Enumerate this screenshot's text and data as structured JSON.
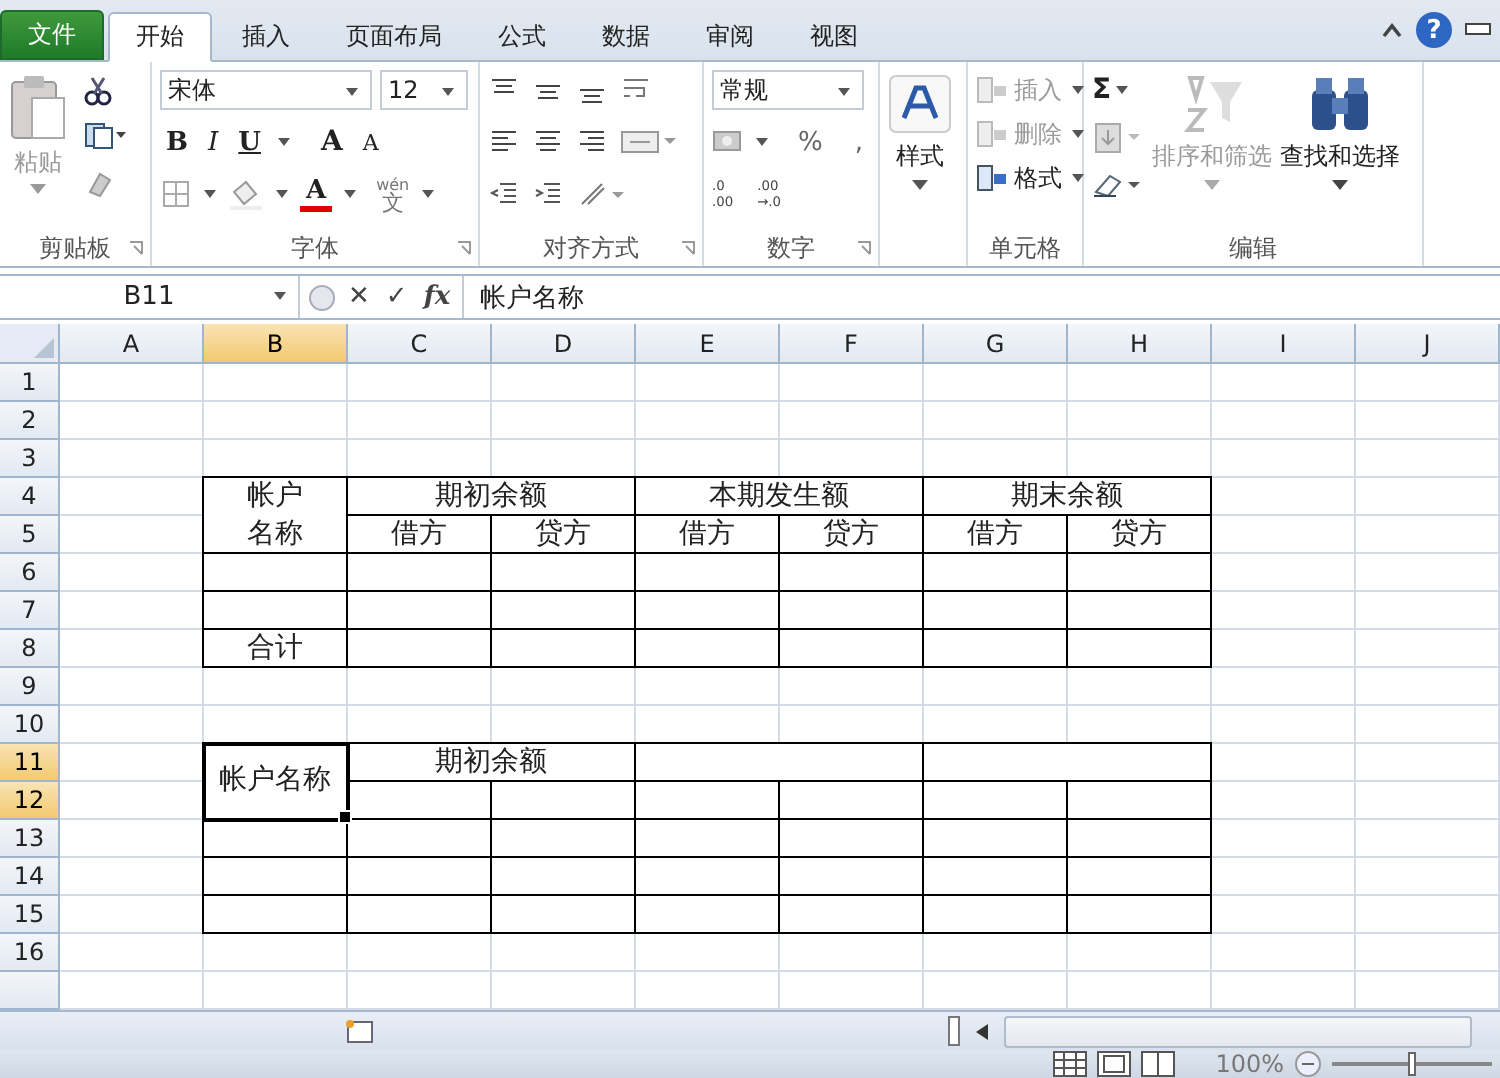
{
  "tabs": [
    {
      "label": "文件",
      "kind": "file",
      "selected": false
    },
    {
      "label": "开始",
      "kind": "tab",
      "selected": true
    },
    {
      "label": "插入",
      "kind": "tab",
      "selected": false
    },
    {
      "label": "页面布局",
      "kind": "tab",
      "selected": false
    },
    {
      "label": "公式",
      "kind": "tab",
      "selected": false
    },
    {
      "label": "数据",
      "kind": "tab",
      "selected": false
    },
    {
      "label": "审阅",
      "kind": "tab",
      "selected": false
    },
    {
      "label": "视图",
      "kind": "tab",
      "selected": false
    }
  ],
  "help": "?",
  "ribbon": {
    "groups": [
      {
        "kind": "clipboard",
        "label": "剪贴板",
        "paste": {
          "label": "粘贴",
          "disabled": true
        }
      },
      {
        "kind": "font",
        "label": "字体",
        "font_name": "宋体",
        "font_size": "12",
        "bold": "B",
        "italic": "I",
        "underline": "U",
        "grow": "A",
        "shrink": "A",
        "font_color": {
          "letter": "A",
          "color": "#e00000"
        },
        "phonetic": {
          "top": "wén",
          "bottom": "文"
        }
      },
      {
        "kind": "alignment",
        "label": "对齐方式"
      },
      {
        "kind": "number",
        "label": "数字",
        "format": "常规",
        "percent": "%",
        "comma": ",",
        "decimals": [
          {
            "top": ".0",
            "bottom": ".00"
          },
          {
            "top": ".00",
            "bottom": "→.0"
          }
        ]
      },
      {
        "kind": "styles",
        "button": "样式"
      },
      {
        "kind": "cells",
        "label": "单元格",
        "items": [
          {
            "label": "插入",
            "disabled": true
          },
          {
            "label": "删除",
            "disabled": true
          },
          {
            "label": "格式",
            "disabled": false
          }
        ]
      },
      {
        "kind": "editing",
        "label": "编辑",
        "sum": "Σ",
        "sort": {
          "label": "排序和筛选",
          "disabled": true
        },
        "find": {
          "label": "查找和选择",
          "disabled": false
        }
      }
    ]
  },
  "formula_bar": {
    "name_box": "B11",
    "cancel": "✕",
    "enter": "✓",
    "function_label": "fx",
    "formula": "帐户名称"
  },
  "sheet": {
    "columns": [
      {
        "label": "A",
        "selected": false
      },
      {
        "label": "B",
        "selected": true
      },
      {
        "label": "C",
        "selected": false
      },
      {
        "label": "D",
        "selected": false
      },
      {
        "label": "E",
        "selected": false
      },
      {
        "label": "F",
        "selected": false
      },
      {
        "label": "G",
        "selected": false
      },
      {
        "label": "H",
        "selected": false
      },
      {
        "label": "I",
        "selected": false
      },
      {
        "label": "J",
        "selected": false
      }
    ],
    "rows": [
      {
        "label": "1",
        "selected": false
      },
      {
        "label": "2",
        "selected": false
      },
      {
        "label": "3",
        "selected": false
      },
      {
        "label": "4",
        "selected": false,
        "cells": [
          {
            "kind": "tall",
            "wrap": true,
            "text": "帐户名称",
            "selected": false
          },
          {
            "kind": "wide",
            "text": "期初余额",
            "selected": false
          },
          {
            "kind": "wide",
            "text": "本期发生额",
            "selected": false
          },
          {
            "kind": "wide",
            "text": "期末余额",
            "selected": false
          }
        ]
      },
      {
        "label": "5",
        "selected": false,
        "cells": [
          {
            "kind": "single",
            "text": "借方",
            "selected": false
          },
          {
            "kind": "single",
            "text": "贷方",
            "selected": false
          },
          {
            "kind": "single",
            "text": "借方",
            "selected": false
          },
          {
            "kind": "single",
            "text": "贷方",
            "selected": false
          },
          {
            "kind": "single",
            "text": "借方",
            "selected": false
          },
          {
            "kind": "single",
            "text": "贷方",
            "selected": false
          }
        ]
      },
      {
        "label": "6",
        "selected": false,
        "cells": [
          {
            "kind": "single",
            "selected": false
          },
          {
            "kind": "single",
            "selected": false
          },
          {
            "kind": "single",
            "selected": false
          },
          {
            "kind": "single",
            "selected": false
          },
          {
            "kind": "single",
            "selected": false
          },
          {
            "kind": "single",
            "selected": false
          },
          {
            "kind": "single",
            "selected": false
          }
        ]
      },
      {
        "label": "7",
        "selected": false,
        "cells": [
          {
            "kind": "single",
            "selected": false
          },
          {
            "kind": "single",
            "selected": false
          },
          {
            "kind": "single",
            "selected": false
          },
          {
            "kind": "single",
            "selected": false
          },
          {
            "kind": "single",
            "selected": false
          },
          {
            "kind": "single",
            "selected": false
          },
          {
            "kind": "single",
            "selected": false
          }
        ]
      },
      {
        "label": "8",
        "selected": false,
        "cells": [
          {
            "kind": "single",
            "text": "合计",
            "selected": false
          },
          {
            "kind": "single",
            "selected": false
          },
          {
            "kind": "single",
            "selected": false
          },
          {
            "kind": "single",
            "selected": false
          },
          {
            "kind": "single",
            "selected": false
          },
          {
            "kind": "single",
            "selected": false
          },
          {
            "kind": "single",
            "selected": false
          }
        ]
      },
      {
        "label": "9",
        "selected": false
      },
      {
        "label": "10",
        "selected": false
      },
      {
        "label": "11",
        "selected": true,
        "cells": [
          {
            "kind": "tall",
            "wrap": false,
            "text": "帐户名称",
            "selected": true
          },
          {
            "kind": "wide",
            "text": "期初余额",
            "selected": false
          },
          {
            "kind": "wide",
            "selected": false
          },
          {
            "kind": "wide",
            "selected": false
          }
        ]
      },
      {
        "label": "12",
        "selected": true,
        "cells": [
          {
            "kind": "single",
            "selected": false
          },
          {
            "kind": "single",
            "selected": false
          },
          {
            "kind": "single",
            "selected": false
          },
          {
            "kind": "single",
            "selected": false
          },
          {
            "kind": "single",
            "selected": false
          },
          {
            "kind": "single",
            "selected": false
          }
        ]
      },
      {
        "label": "13",
        "selected": false,
        "cells": [
          {
            "kind": "single",
            "selected": false
          },
          {
            "kind": "single",
            "selected": false
          },
          {
            "kind": "single",
            "selected": false
          },
          {
            "kind": "single",
            "selected": false
          },
          {
            "kind": "single",
            "selected": false
          },
          {
            "kind": "single",
            "selected": false
          },
          {
            "kind": "single",
            "selected": false
          }
        ]
      },
      {
        "label": "14",
        "selected": false,
        "cells": [
          {
            "kind": "single",
            "selected": false
          },
          {
            "kind": "single",
            "selected": false
          },
          {
            "kind": "single",
            "selected": false
          },
          {
            "kind": "single",
            "selected": false
          },
          {
            "kind": "single",
            "selected": false
          },
          {
            "kind": "single",
            "selected": false
          },
          {
            "kind": "single",
            "selected": false
          }
        ]
      },
      {
        "label": "15",
        "selected": false,
        "cells": [
          {
            "kind": "single",
            "selected": false
          },
          {
            "kind": "single",
            "selected": false
          },
          {
            "kind": "single",
            "selected": false
          },
          {
            "kind": "single",
            "selected": false
          },
          {
            "kind": "single",
            "selected": false
          },
          {
            "kind": "single",
            "selected": false
          },
          {
            "kind": "single",
            "selected": false
          }
        ]
      },
      {
        "label": "16",
        "selected": false
      }
    ]
  },
  "status_bar": {
    "zoom": "100%",
    "zoom_slider": {
      "level": 0.5
    }
  }
}
